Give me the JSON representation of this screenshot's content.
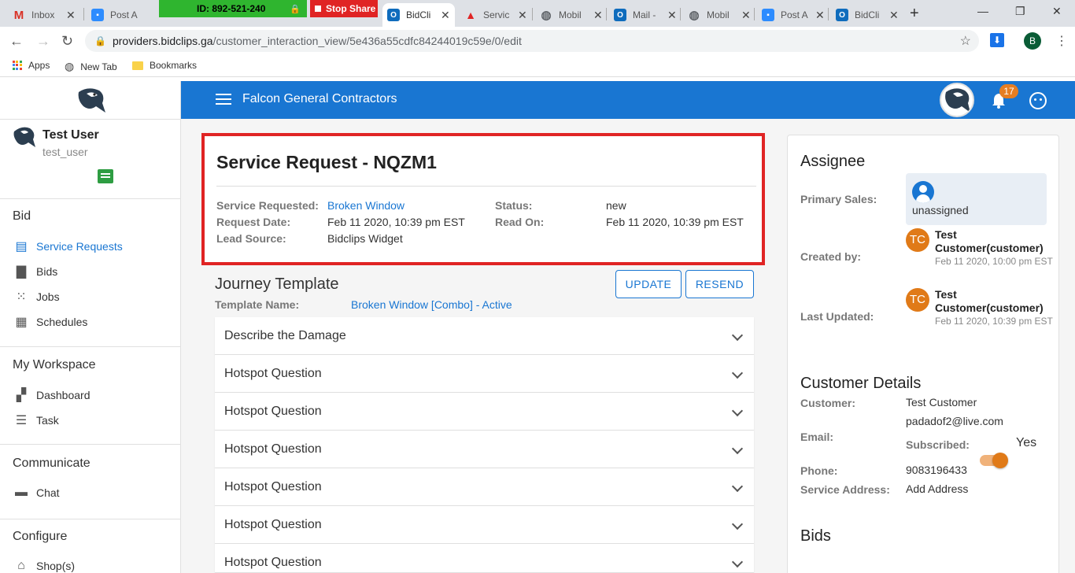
{
  "browser": {
    "tabs": [
      {
        "title": "Inbox",
        "favicon": "gmail-icon",
        "color": "#d93025",
        "glyph": "M"
      },
      {
        "title": "Post A",
        "favicon": "zoom-icon",
        "color": "#2d8cff",
        "glyph": ""
      },
      {
        "title": "BidCli",
        "favicon": "outlook-icon",
        "color": "#0f6cbd",
        "glyph": "O",
        "active": true
      },
      {
        "title": "Servic",
        "favicon": "bidclips-icon",
        "color": "#e02424",
        "glyph": ""
      },
      {
        "title": "Mobil",
        "favicon": "globe-icon",
        "color": "#5f6368",
        "glyph": ""
      },
      {
        "title": "Mail -",
        "favicon": "outlook-icon",
        "color": "#0f6cbd",
        "glyph": "O"
      },
      {
        "title": "Mobil",
        "favicon": "globe-icon",
        "color": "#5f6368",
        "glyph": ""
      },
      {
        "title": "Post A",
        "favicon": "zoom-icon",
        "color": "#2d8cff",
        "glyph": ""
      },
      {
        "title": "BidCli",
        "favicon": "outlook-icon",
        "color": "#0f6cbd",
        "glyph": "O"
      }
    ],
    "zoom_meeting_id": "ID: 892-521-240",
    "stop_share_label": "Stop Share",
    "url_host": "providers.bidclips.ga",
    "url_path": "/customer_interaction_view/5e436a55cdfc84244019c59e/0/edit",
    "profile_initial": "B",
    "bookmarks": [
      {
        "label": "Apps",
        "icon": "apps-grid-icon"
      },
      {
        "label": "New Tab",
        "icon": "globe-icon"
      },
      {
        "label": "Bookmarks",
        "icon": "folder-icon"
      }
    ]
  },
  "header": {
    "company_name": "Falcon General Contractors",
    "notification_count": "17"
  },
  "sidebar": {
    "user_name": "Test User",
    "user_handle": "test_user",
    "sections": [
      {
        "title": "Bid",
        "items": [
          {
            "label": "Service Requests",
            "icon": "id-card-icon",
            "active": true
          },
          {
            "label": "Bids",
            "icon": "document-icon"
          },
          {
            "label": "Jobs",
            "icon": "grid-icon"
          },
          {
            "label": "Schedules",
            "icon": "calendar-icon"
          }
        ]
      },
      {
        "title": "My Workspace",
        "items": [
          {
            "label": "Dashboard",
            "icon": "dashboard-icon"
          },
          {
            "label": "Task",
            "icon": "list-icon"
          }
        ]
      },
      {
        "title": "Communicate",
        "items": [
          {
            "label": "Chat",
            "icon": "chat-icon"
          }
        ]
      },
      {
        "title": "Configure",
        "items": [
          {
            "label": "Shop(s)",
            "icon": "shop-icon"
          }
        ]
      }
    ]
  },
  "request": {
    "title": "Service Request - NQZM1",
    "service_requested_label": "Service Requested:",
    "service_requested": "Broken Window",
    "request_date_label": "Request Date:",
    "request_date": "Feb 11 2020, 10:39 pm EST",
    "lead_source_label": "Lead Source:",
    "lead_source": "Bidclips Widget",
    "status_label": "Status:",
    "status": "new",
    "read_on_label": "Read On:",
    "read_on": "Feb 11 2020, 10:39 pm EST"
  },
  "journey": {
    "title": "Journey Template",
    "template_name_label": "Template Name:",
    "template_name": "Broken Window [Combo] - Active",
    "update_label": "UPDATE",
    "resend_label": "RESEND",
    "questions": [
      "Describe the Damage",
      "Hotspot Question",
      "Hotspot Question",
      "Hotspot Question",
      "Hotspot Question",
      "Hotspot Question",
      "Hotspot Question"
    ]
  },
  "assignee": {
    "title": "Assignee",
    "primary_sales_label": "Primary Sales:",
    "primary_sales": "unassigned",
    "created_by_label": "Created by:",
    "created_by_initials": "TC",
    "created_by_name": "Test Customer(customer)",
    "created_by_date": "Feb 11 2020, 10:00 pm EST",
    "last_updated_label": "Last Updated:",
    "last_updated_initials": "TC",
    "last_updated_name": "Test Customer(customer)",
    "last_updated_date": "Feb 11 2020, 10:39 pm EST"
  },
  "customer": {
    "title": "Customer Details",
    "customer_label": "Customer:",
    "customer_name": "Test Customer",
    "email_label": "Email:",
    "email": "padadof2@live.com",
    "subscribed_label": "Subscribed:",
    "subscribed_value": "Yes",
    "phone_label": "Phone:",
    "phone": "9083196433",
    "address_label": "Service Address:",
    "address_action": "Add Address"
  },
  "bids": {
    "title": "Bids"
  },
  "colors": {
    "primary": "#1976d2",
    "highlight_border": "#e02424",
    "avatar_orange": "#e07a18"
  }
}
